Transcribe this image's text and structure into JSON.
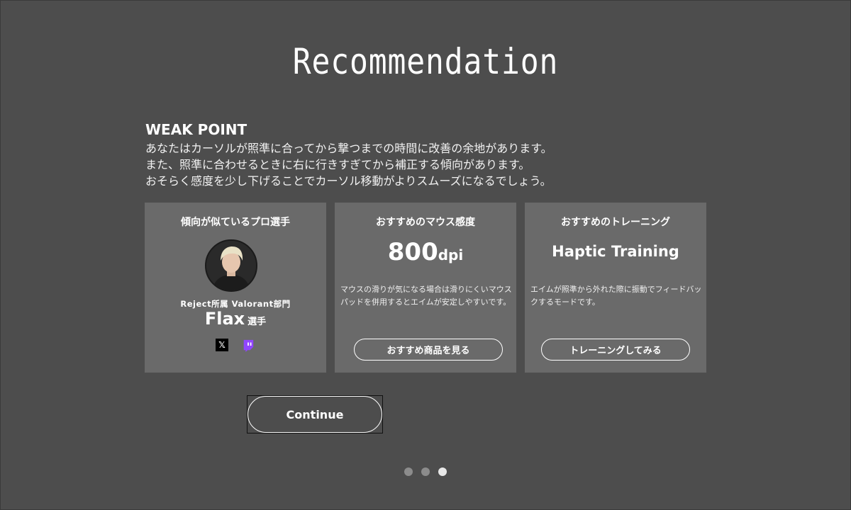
{
  "page": {
    "title": "Recommendation"
  },
  "weak_point": {
    "heading": "WEAK POINT",
    "lines": [
      "あなたはカーソルが照準に合ってから撃つまでの時間に改善の余地があります。",
      "また、照準に合わせるときに右に行きすぎてから補正する傾向があります。",
      "おそらく感度を少し下げることでカーソル移動がよりスムーズになるでしょう。"
    ]
  },
  "cards": {
    "pro": {
      "title": "傾向が似ているプロ選手",
      "team": "Reject所属 Valorant部門",
      "name": "Flax",
      "suffix": "選手",
      "socials": [
        {
          "icon": "x-icon",
          "glyph": "𝕏"
        },
        {
          "icon": "twitch-icon",
          "glyph": ""
        }
      ]
    },
    "sensitivity": {
      "title": "おすすめのマウス感度",
      "value": "800",
      "unit": "dpi",
      "description": "マウスの滑りが気になる場合は滑りにくいマウスパッドを併用するとエイムが安定しやすいです。",
      "button": "おすすめ商品を見る"
    },
    "training": {
      "title": "おすすめのトレーニング",
      "name": "Haptic Training",
      "description": "エイムが照準から外れた際に振動でフィードバックするモードです。",
      "button": "トレーニングしてみる"
    }
  },
  "actions": {
    "continue": "Continue"
  },
  "pagination": {
    "total": 3,
    "current": 3
  },
  "colors": {
    "background": "#4d4d4d",
    "card": "#6a6a6a",
    "twitch": "#9146ff"
  }
}
